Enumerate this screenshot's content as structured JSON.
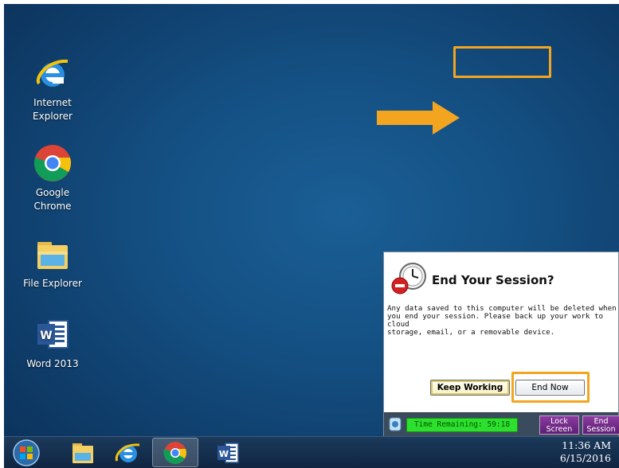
{
  "desktop": {
    "icons": [
      {
        "label": "Internet\nExplorer",
        "icon": "internet-explorer-icon"
      },
      {
        "label": "Google\nChrome",
        "icon": "chrome-icon"
      },
      {
        "label": "File Explorer",
        "icon": "folder-icon"
      },
      {
        "label": "Word 2013",
        "icon": "word-icon"
      }
    ]
  },
  "colors": {
    "highlight": "#f3a51f",
    "desktop": "#144f82",
    "timer_green": "#2de02d",
    "session_button": "#6b2a85"
  },
  "dialog": {
    "title": "End Your Session?",
    "message": "Any data saved to this computer will be deleted when\nyou end your session. Please back up your work to cloud\nstorage, email, or a removable device.",
    "keep_label": "Keep Working",
    "end_label": "End Now",
    "time_remaining": "Time Remaining: 59:18",
    "lock_label": "Lock\nScreen",
    "end_session_label": "End\nSession"
  },
  "taskbar": {
    "items": [
      "start-button",
      "file-explorer",
      "internet-explorer",
      "chrome",
      "word"
    ],
    "time": "11:36 AM",
    "date": "6/15/2016"
  }
}
